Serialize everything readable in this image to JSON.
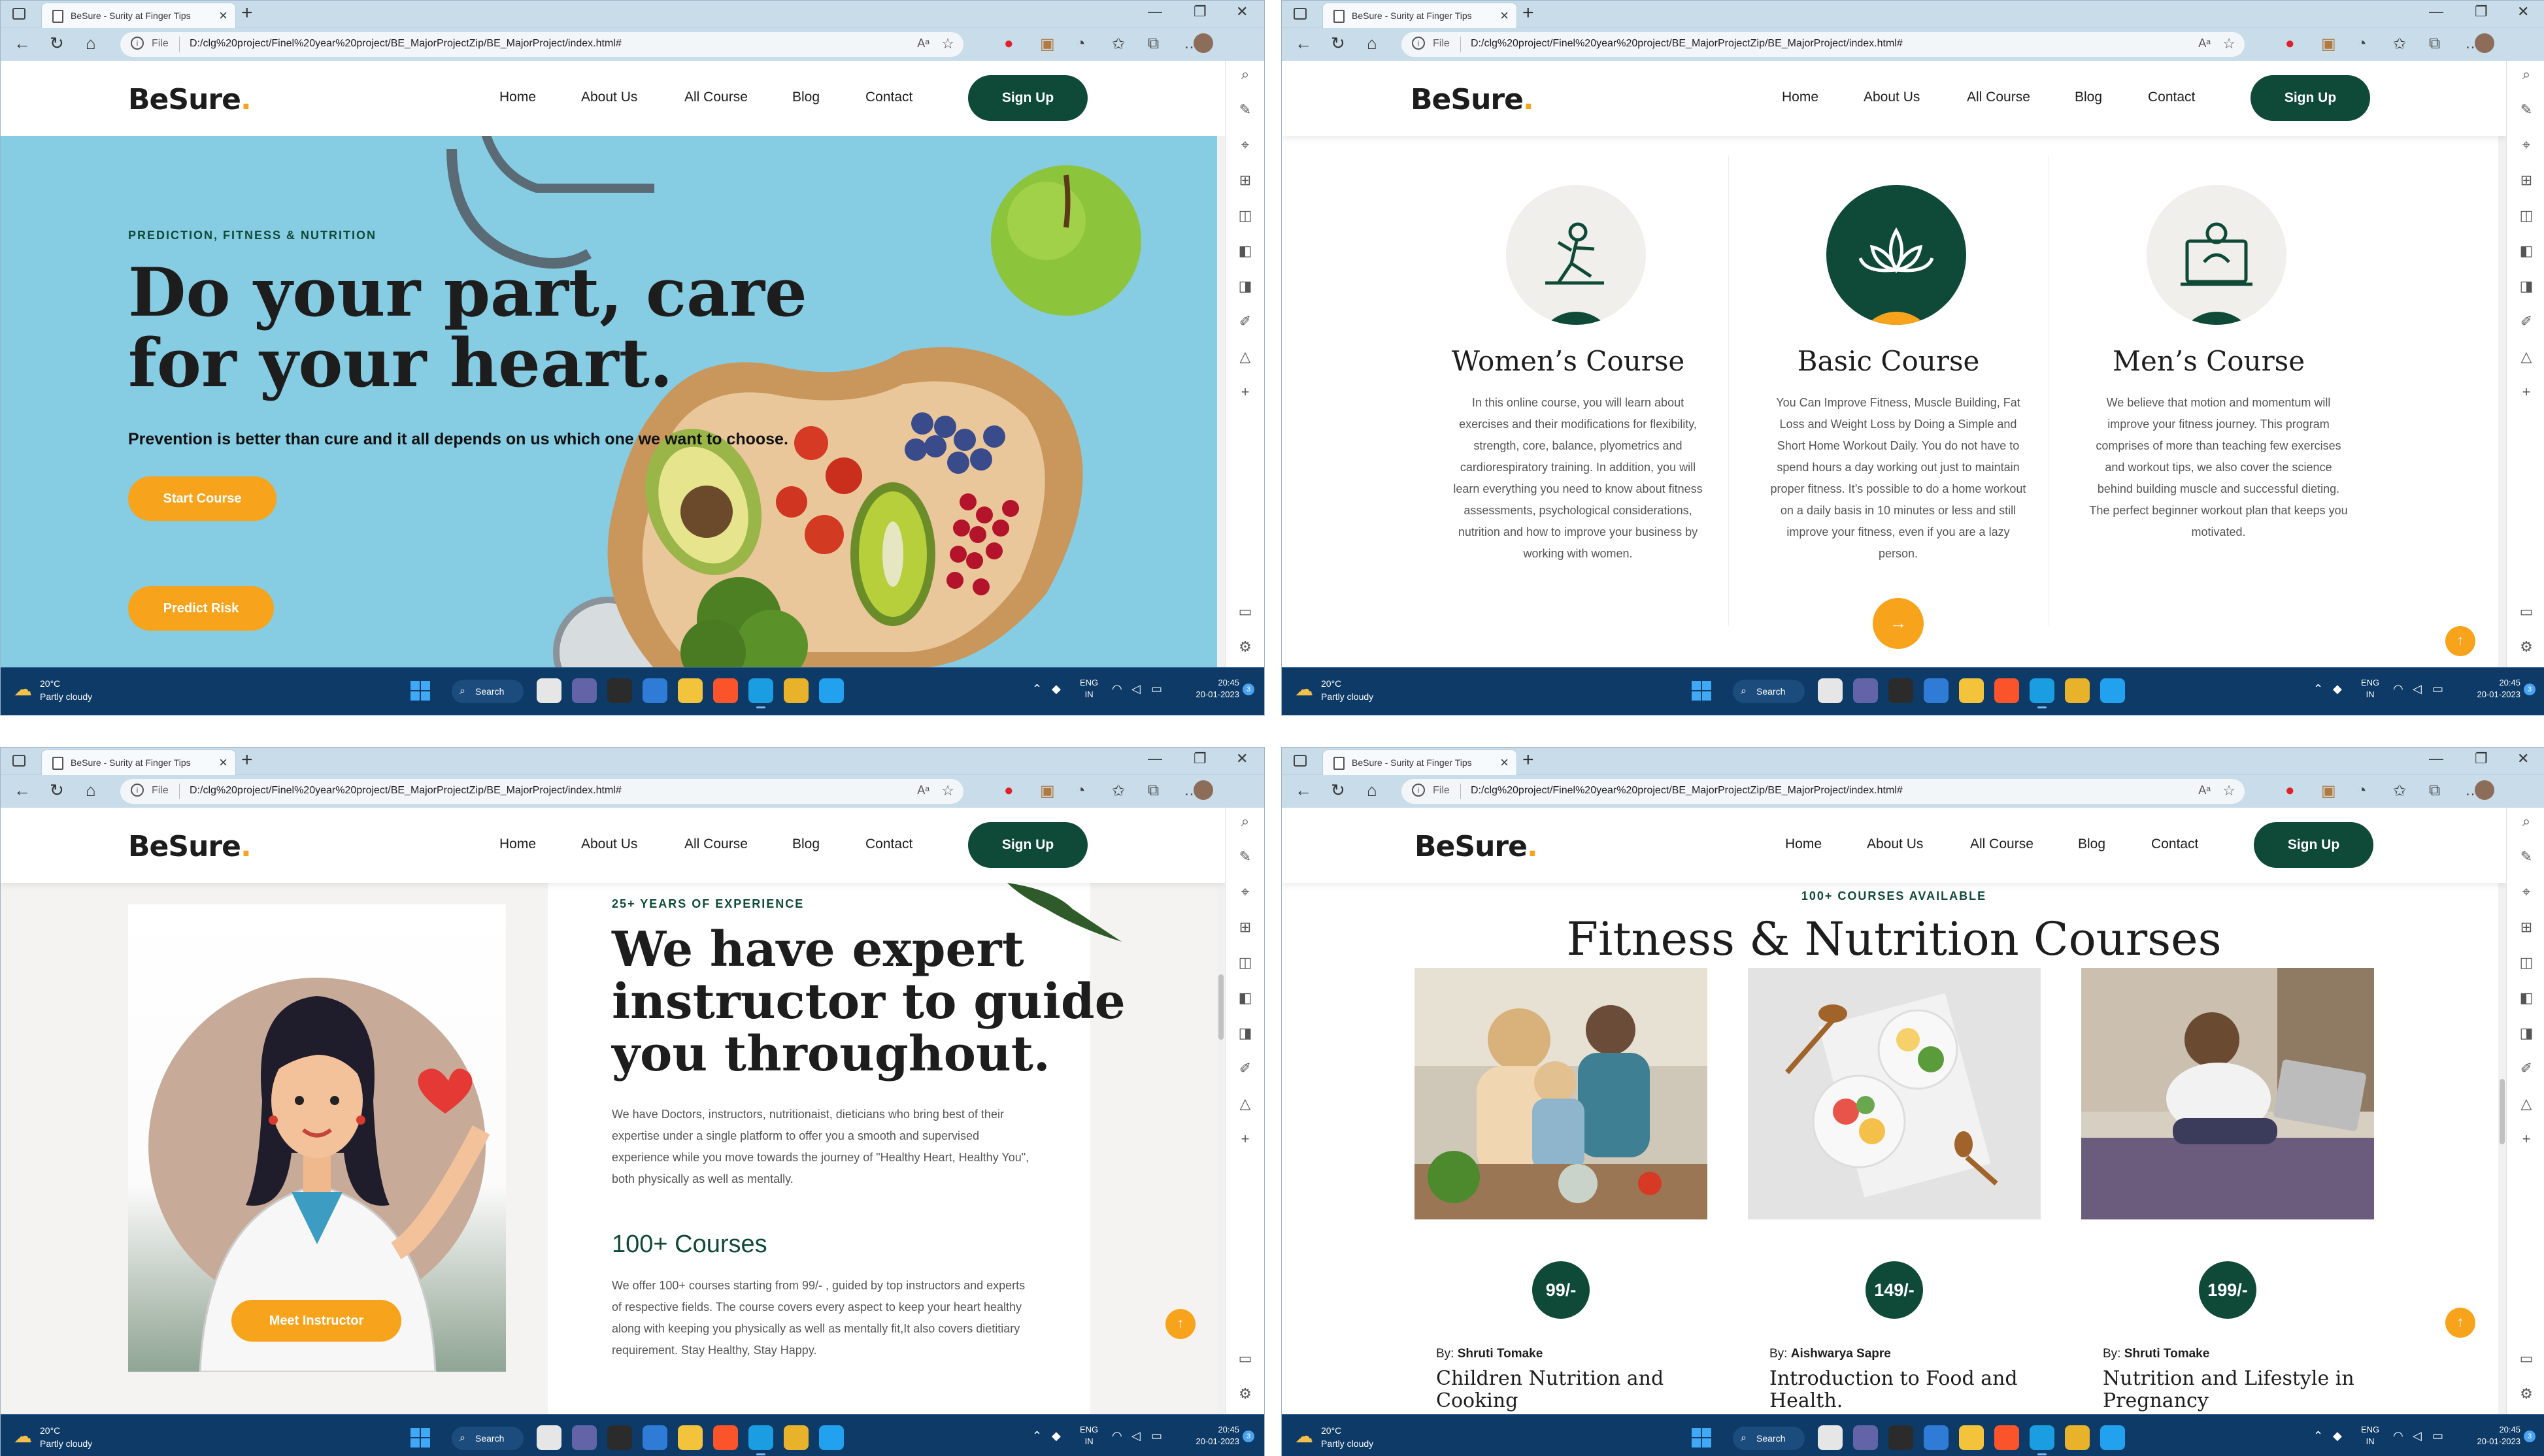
{
  "browser": {
    "tab_title": "BeSure - Surity at Finger Tips",
    "url_prefix": "File",
    "url": "D:/clg%20project/Finel%20year%20project/BE_MajorProjectZip/BE_MajorProject/index.html#",
    "icons": [
      "back-icon",
      "refresh-icon",
      "home-icon",
      "read-aloud-icon",
      "favorite-icon",
      "opera-icon",
      "extension-icon",
      "performance-icon",
      "favorites-icon",
      "collections-icon",
      "profile-icon"
    ]
  },
  "site": {
    "logo": "BeSure",
    "logo_dot": ".",
    "nav": [
      "Home",
      "About Us",
      "All Course",
      "Blog",
      "Contact"
    ],
    "signup": "Sign Up",
    "accent": "#f7a31c",
    "brand": "#0f4a38"
  },
  "hero": {
    "eyebrow": "PREDICTION, FITNESS & NUTRITION",
    "title_line1": "Do your part, care",
    "title_line2": "for your heart.",
    "subtitle": "Prevention is better than cure and it all depends on us which one we want to choose.",
    "start_btn": "Start Course",
    "predict_btn": "Predict Risk"
  },
  "courses": [
    {
      "title": "Women’s Course",
      "desc": "In this online course, you will learn about exercises and their modifications for flexibility, strength, core, balance, plyometrics and cardiorespiratory training. In addition, you will learn everything you need to know about fitness assessments, psychological considerations, nutrition and how to improve your business by working with women."
    },
    {
      "title": "Basic Course",
      "desc": "You Can Improve Fitness, Muscle Building, Fat Loss and Weight Loss by Doing a Simple and Short Home Workout Daily. You do not have to spend hours a day working out just to maintain proper fitness. It’s possible to do a home workout on a daily basis in 10 minutes or less and still improve your fitness, even if you are a lazy person."
    },
    {
      "title": "Men’s Course",
      "desc": "We believe that motion and momentum will improve your fitness journey. This program comprises of more than teaching few exercises and workout tips, we also cover the science behind building muscle and successful dieting. The perfect beginner workout plan that keeps you motivated."
    }
  ],
  "about": {
    "eyebrow": "25+ YEARS OF EXPERIENCE",
    "title_l1": "We have expert",
    "title_l2": "instructor to guide",
    "title_l3": "you throughout.",
    "para1": "We have Doctors, instructors, nutritionaist, dieticians who bring best of their expertise under a single platform to offer you a smooth and supervised experience while you move towards the journey of \"Healthy Heart, Healthy You\", both physically as well as mentally.",
    "sub_title": "100+ Courses",
    "para2": "We offer 100+ courses starting from 99/- , guided by top instructors and experts of respective fields. The course covers every aspect to keep your heart healthy along with keeping you physically as well as mentally fit,It also covers dietitiary requirement. Stay Healthy, Stay Happy.",
    "meet_btn": "Meet Instructor"
  },
  "catalog": {
    "eyebrow": "100+ COURSES AVAILABLE",
    "title": "Fitness & Nutrition Courses",
    "by_label": "By:",
    "cards": [
      {
        "price": "99/-",
        "author": "Shruti Tomake",
        "name": "Children Nutrition and Cooking"
      },
      {
        "price": "149/-",
        "author": "Aishwarya Sapre",
        "name": "Introduction to Food and Health."
      },
      {
        "price": "199/-",
        "author": "Shruti Tomake",
        "name": "Nutrition and Lifestyle in Pregnancy"
      }
    ]
  },
  "taskbar": {
    "temp": "20°C",
    "weather": "Partly cloudy",
    "search": "Search",
    "lang1": "ENG",
    "lang2": "IN",
    "time": "20:45",
    "date": "20-01-2023",
    "notif": "3"
  }
}
